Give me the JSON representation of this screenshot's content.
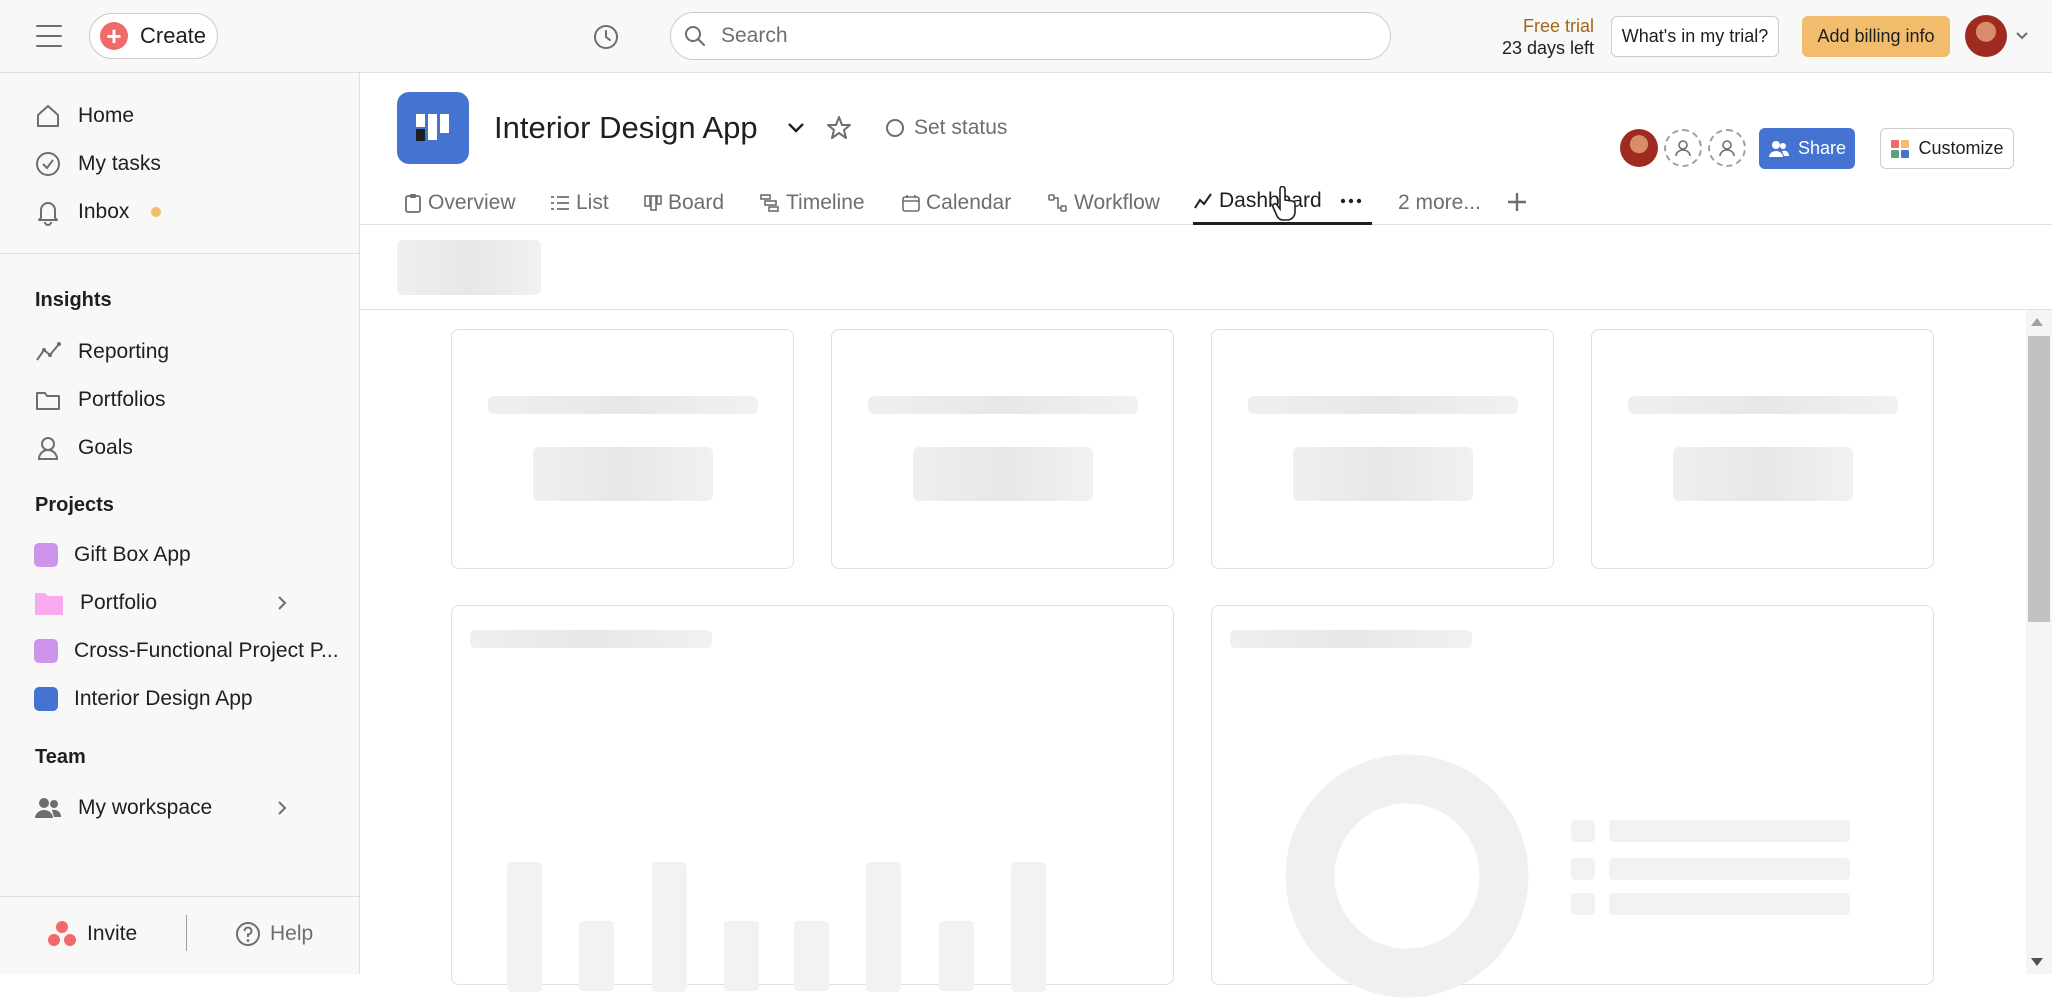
{
  "topbar": {
    "create_label": "Create",
    "search_placeholder": "Search",
    "trial_line1": "Free trial",
    "trial_line2": "23 days left",
    "trial_button": "What's in my trial?",
    "billing_button": "Add billing info"
  },
  "sidebar": {
    "nav": [
      {
        "label": "Home",
        "icon": "home-icon"
      },
      {
        "label": "My tasks",
        "icon": "check-circle-icon"
      },
      {
        "label": "Inbox",
        "icon": "bell-icon"
      }
    ],
    "insights_title": "Insights",
    "insights": [
      {
        "label": "Reporting",
        "icon": "reporting-icon"
      },
      {
        "label": "Portfolios",
        "icon": "folder-icon"
      },
      {
        "label": "Goals",
        "icon": "goals-icon"
      }
    ],
    "projects_title": "Projects",
    "projects": [
      {
        "label": "Gift Box App",
        "color": "#cd95ea"
      },
      {
        "label": "Portfolio",
        "color": "#f9aaef"
      },
      {
        "label": "Cross-Functional Project P...",
        "color": "#cd95ea"
      },
      {
        "label": "Interior Design App",
        "color": "#4573d2"
      }
    ],
    "team_title": "Team",
    "team": [
      {
        "label": "My workspace",
        "icon": "people-icon"
      }
    ],
    "invite_label": "Invite",
    "help_label": "Help"
  },
  "project": {
    "title": "Interior Design App",
    "set_status": "Set status",
    "share_label": "Share",
    "customize_label": "Customize",
    "color": "#4573d2"
  },
  "tabs": [
    {
      "label": "Overview"
    },
    {
      "label": "List"
    },
    {
      "label": "Board"
    },
    {
      "label": "Timeline"
    },
    {
      "label": "Calendar"
    },
    {
      "label": "Workflow"
    },
    {
      "label": "Dashboard"
    },
    {
      "label": "2 more..."
    }
  ]
}
